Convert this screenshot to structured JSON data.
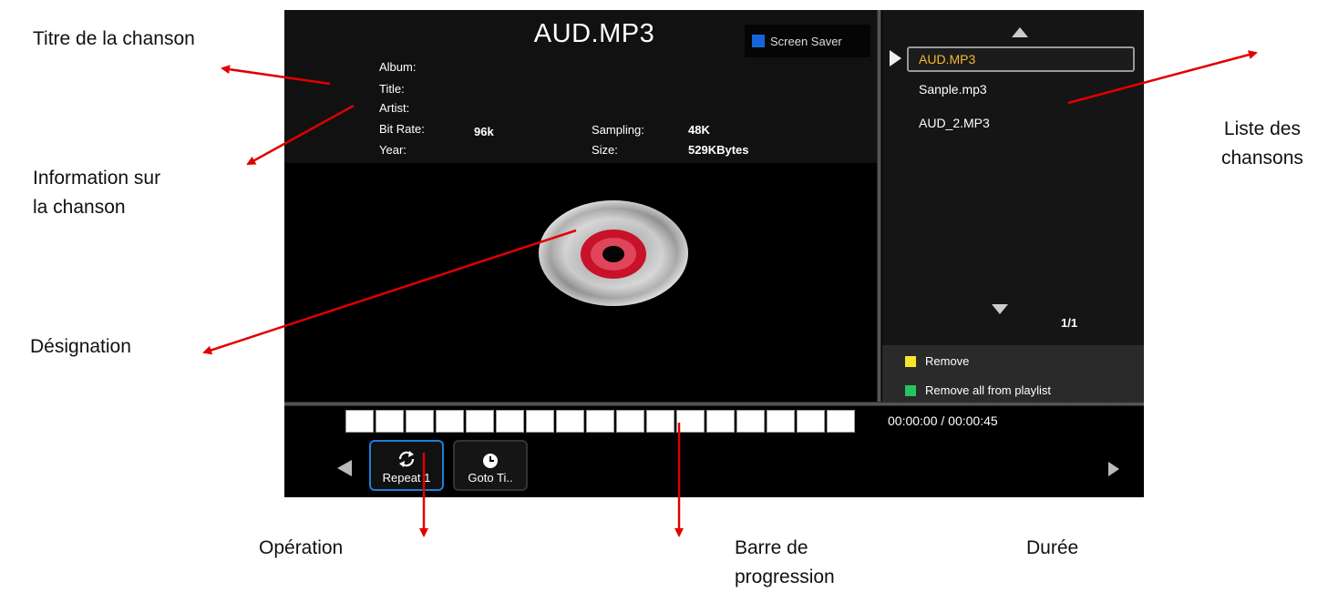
{
  "annotations": {
    "titre": "Titre de la chanson",
    "information": "Information sur\nla chanson",
    "designation": "Désignation",
    "liste": "Liste des\nchansons",
    "operation": "Opération",
    "barre": "Barre de\nprogression",
    "duree": "Durée"
  },
  "player": {
    "song_title": "AUD.MP3",
    "screen_saver_label": "Screen Saver",
    "screen_saver_color": "#1565d8",
    "info": {
      "album_label": "Album:",
      "title_label": "Title:",
      "artist_label": "Artist:",
      "bitrate_label": "Bit Rate:",
      "bitrate_value": "96k",
      "year_label": "Year:",
      "sampling_label": "Sampling:",
      "sampling_value": "48K",
      "size_label": "Size:",
      "size_value": "529KBytes"
    },
    "artwork_icon": "cd-disc-icon"
  },
  "playlist": {
    "items": [
      {
        "label": "AUD.MP3",
        "active": true
      },
      {
        "label": "Sanple.mp3",
        "active": false
      },
      {
        "label": "AUD_2.MP3",
        "active": false
      }
    ],
    "page_indicator": "1/1",
    "actions": [
      {
        "label": "Remove",
        "color": "#f5e62a"
      },
      {
        "label": "Remove all from playlist",
        "color": "#22c55e"
      }
    ],
    "active_color": "#f5b82a"
  },
  "progress": {
    "segment_count": 17,
    "fraction": 0.0
  },
  "time": {
    "display": "00:00:00 / 00:00:45",
    "current": "00:00:00",
    "total": "00:00:45"
  },
  "operations": [
    {
      "label": "Repeat 1",
      "icon": "repeat-icon",
      "selected": true
    },
    {
      "label": "Goto Ti..",
      "icon": "clock-icon",
      "selected": false
    }
  ],
  "colors": {
    "arrow": "#e00000",
    "selection_border": "#1d7fd6"
  }
}
